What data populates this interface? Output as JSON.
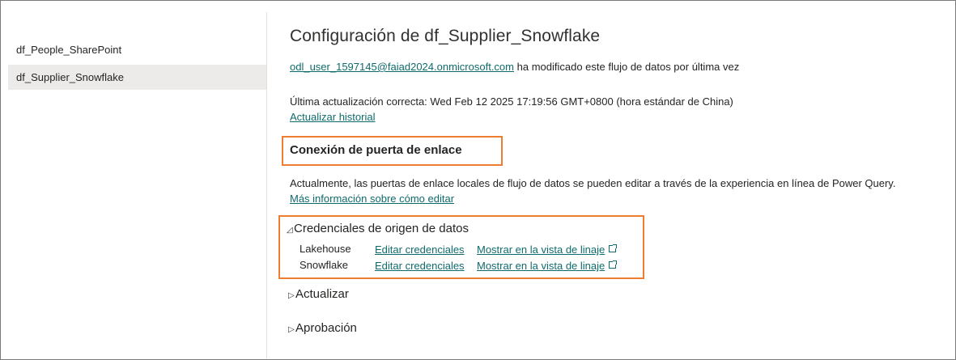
{
  "sidebar": {
    "items": [
      {
        "label": "df_People_SharePoint"
      },
      {
        "label": "df_Supplier_Snowflake"
      }
    ]
  },
  "main": {
    "title": "Configuración de df_Supplier_Snowflake",
    "modified_user": "odl_user_1597145@faiad2024.onmicrosoft.com",
    "modified_text": "ha modificado este flujo de datos por última vez",
    "last_refresh": "Última actualización correcta: Wed Feb 12 2025 17:19:56 GMT+0800 (hora estándar de China)",
    "refresh_history_link": "Actualizar historial",
    "gateway": {
      "heading": "Conexión de puerta de enlace",
      "description": "Actualmente, las puertas de enlace locales de flujo de datos se pueden editar a través de la experiencia en línea de Power Query.",
      "more_info_link": "Más información sobre cómo editar"
    },
    "credentials": {
      "heading": "Credenciales de origen de datos",
      "rows": [
        {
          "source": "Lakehouse",
          "edit": "Editar credenciales",
          "lineage": "Mostrar en la vista de linaje"
        },
        {
          "source": "Snowflake",
          "edit": "Editar credenciales",
          "lineage": "Mostrar en la vista de linaje"
        }
      ]
    },
    "refresh_section": "Actualizar",
    "approval_section": "Aprobación"
  },
  "colors": {
    "link": "#0f6b6b",
    "highlight_border": "#ed7d31",
    "selected_bg": "#edebe9"
  },
  "icons": {
    "expanded": "triangle-expanded-icon",
    "collapsed": "triangle-collapsed-icon",
    "external": "open-external-icon"
  }
}
